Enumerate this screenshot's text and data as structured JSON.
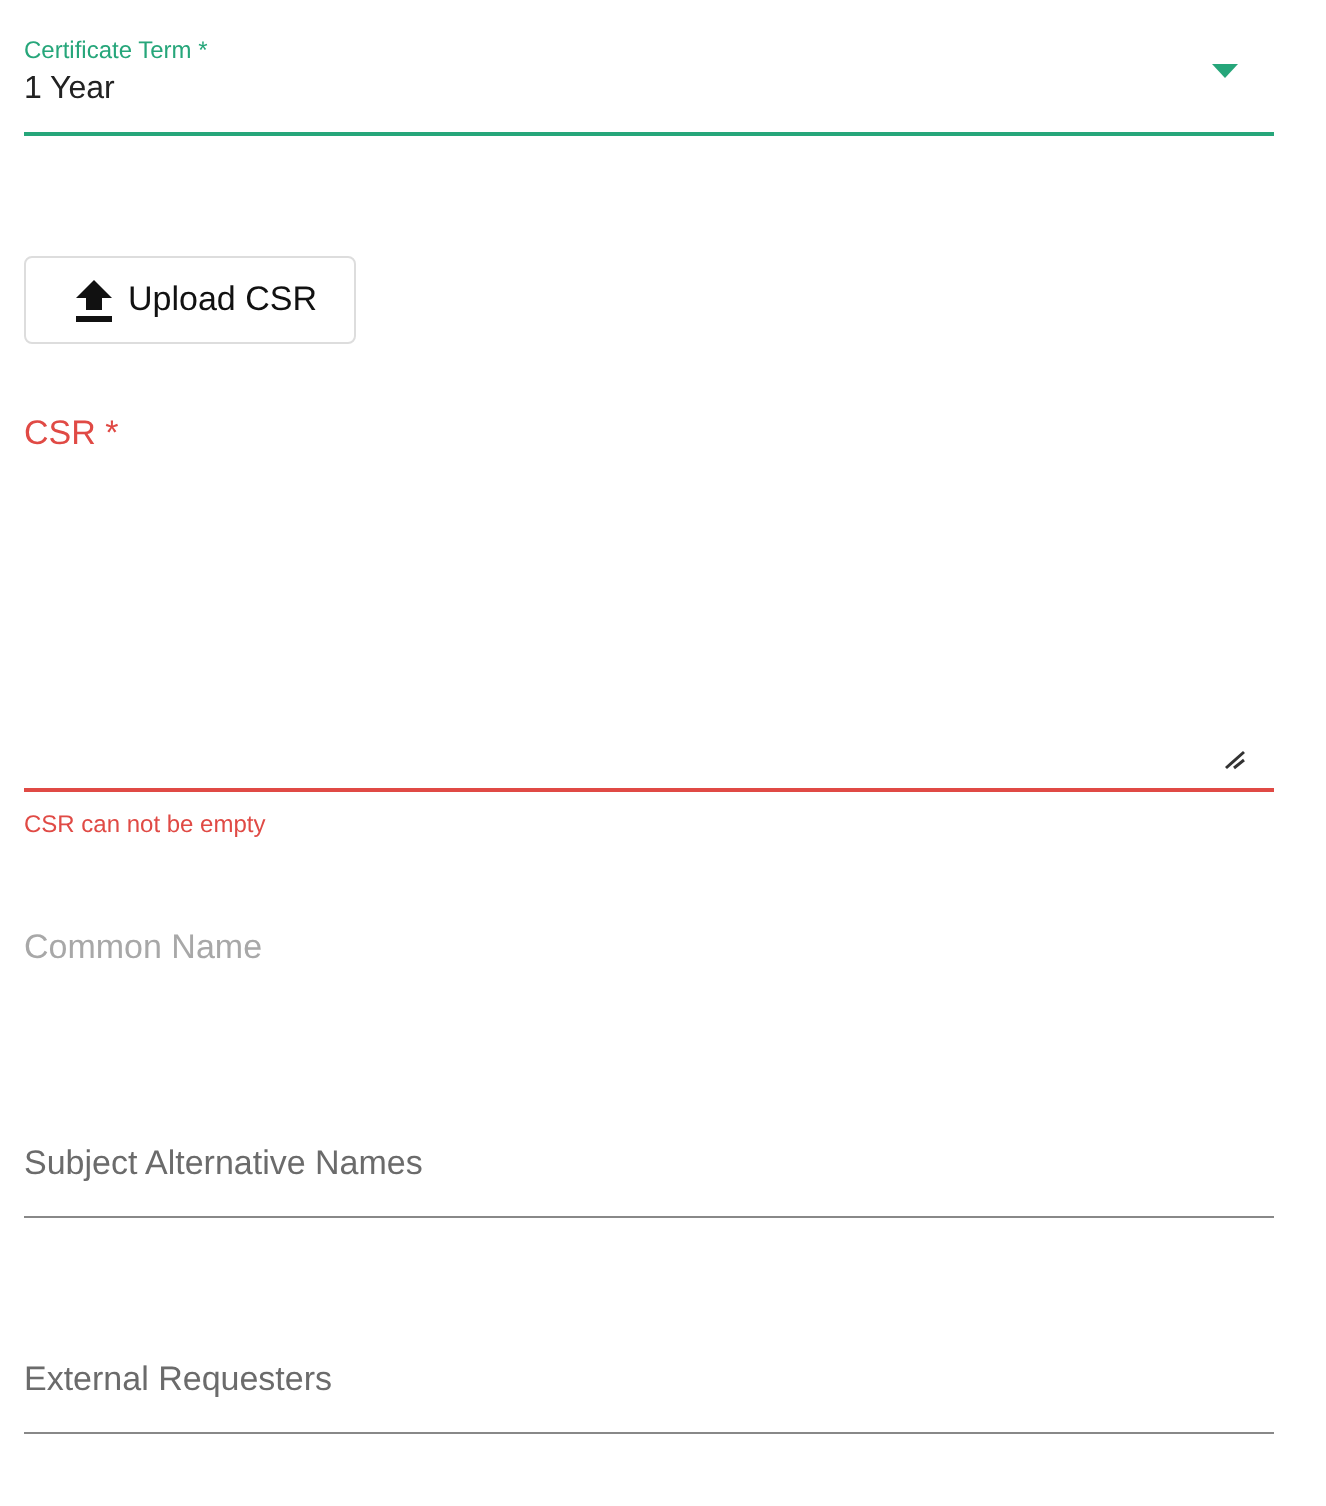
{
  "certificate_term": {
    "label": "Certificate Term *",
    "value": "1 Year",
    "focused": true
  },
  "upload_button": {
    "label": "Upload CSR"
  },
  "csr": {
    "label": "CSR *",
    "error": "CSR can not be empty"
  },
  "text_fields": [
    {
      "label": "Common Name",
      "disabled": true
    },
    {
      "label": "Subject Alternative Names",
      "disabled": false
    },
    {
      "label": "External Requesters",
      "disabled": false
    }
  ]
}
